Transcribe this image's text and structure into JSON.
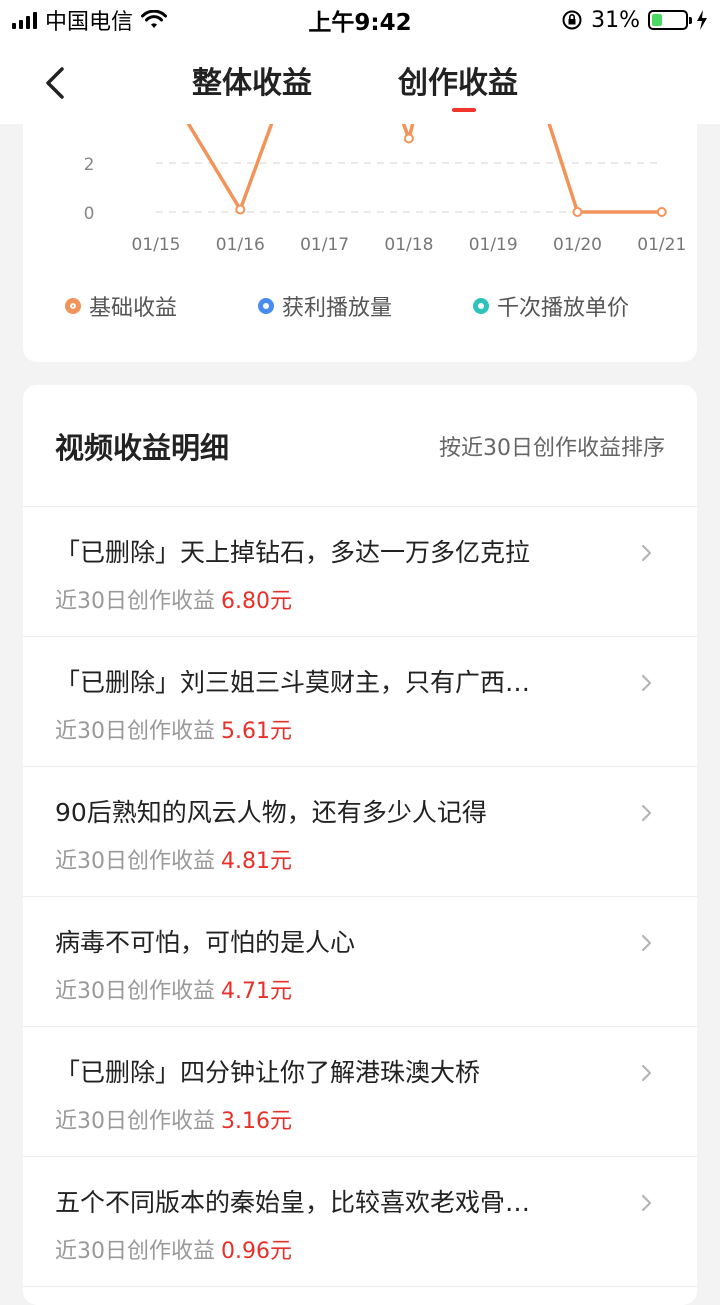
{
  "status": {
    "carrier": "中国电信",
    "time": "上午9:42",
    "battery": "31%",
    "battery_level": 0.31
  },
  "nav": {
    "tabs": [
      {
        "label": "整体收益"
      },
      {
        "label": "创作收益"
      }
    ],
    "active_tab": 1
  },
  "chart_data": {
    "type": "line",
    "x": [
      "01/15",
      "01/16",
      "01/17",
      "01/18",
      "01/19",
      "01/20",
      "01/21"
    ],
    "y_ticks": [
      "2",
      "0"
    ],
    "series": [
      {
        "name": "基础收益",
        "color": "#f2935a"
      },
      {
        "name": "获利播放量",
        "color": "#4a8bef"
      },
      {
        "name": "千次播放单价",
        "color": "#2ec3b9"
      }
    ],
    "visible_points": [
      {
        "x": "01/16",
        "y": 0.1
      },
      {
        "x": "01/18",
        "y": 3.0
      },
      {
        "x": "01/20",
        "y": 0
      },
      {
        "x": "01/21",
        "y": 0
      }
    ],
    "grid": true
  },
  "detail": {
    "title": "视频收益明细",
    "sort_label": "按近30日创作收益排序",
    "sub_label": "近30日创作收益",
    "items": [
      {
        "title": "「已删除」天上掉钻石，多达一万多亿克拉",
        "amount": "6.80元"
      },
      {
        "title": "「已删除」刘三姐三斗莫财主，只有广西…",
        "amount": "5.61元"
      },
      {
        "title": "90后熟知的风云人物，还有多少人记得",
        "amount": "4.81元"
      },
      {
        "title": "病毒不可怕，可怕的是人心",
        "amount": "4.71元"
      },
      {
        "title": "「已删除」四分钟让你了解港珠澳大桥",
        "amount": "3.16元"
      },
      {
        "title": "五个不同版本的秦始皇，比较喜欢老戏骨…",
        "amount": "0.96元"
      }
    ]
  }
}
